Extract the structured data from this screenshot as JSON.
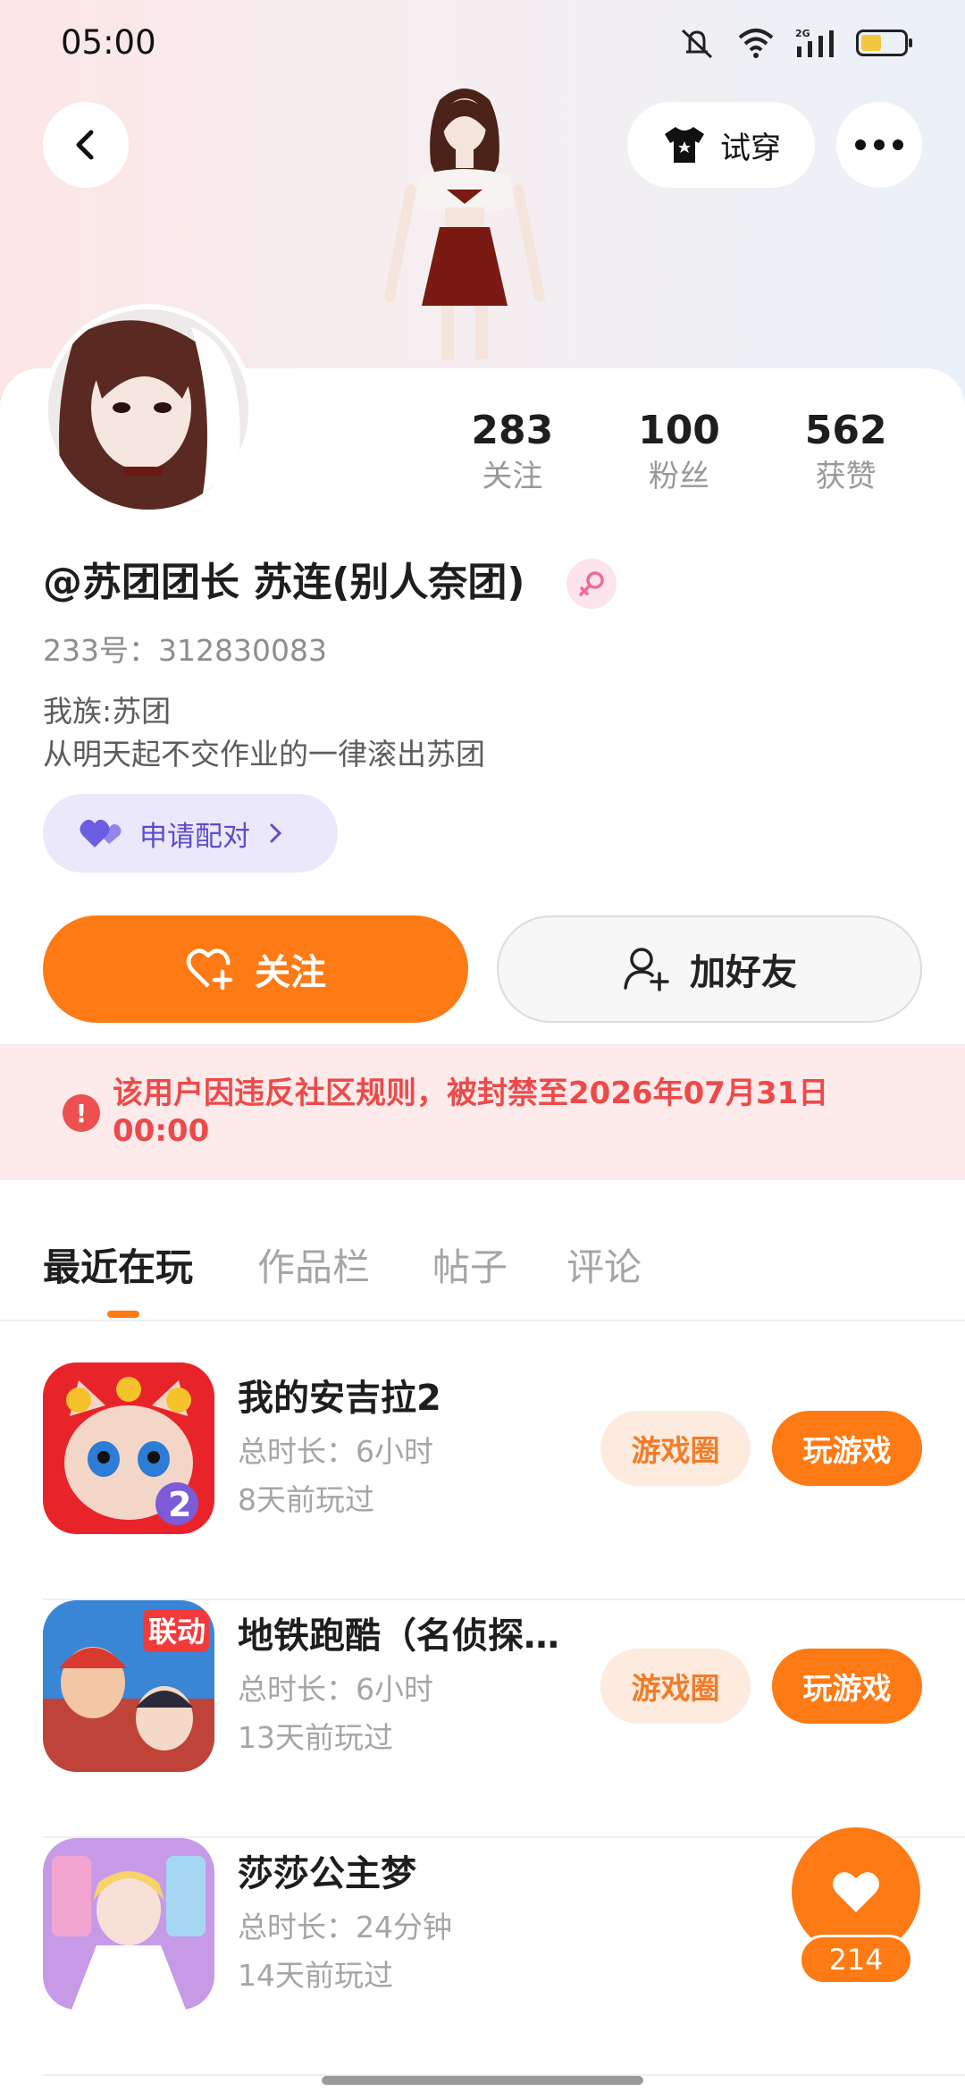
{
  "status_bar": {
    "time": "05:00"
  },
  "header": {
    "tryon_label": "试穿"
  },
  "profile": {
    "stats": [
      {
        "value": "283",
        "label": "关注"
      },
      {
        "value": "100",
        "label": "粉丝"
      },
      {
        "value": "562",
        "label": "获赞"
      }
    ],
    "nickname": "@苏团团长 苏连(别人奈团)",
    "uid": "233号：312830083",
    "bio_line1": "我族:苏团",
    "bio_line2": "从明天起不交作业的一律滚出苏团",
    "pair_label": "申请配对"
  },
  "actions": {
    "follow_label": "关注",
    "add_friend_label": "加好友"
  },
  "ban_notice": "该用户因违反社区规则，被封禁至2026年07月31日 00:00",
  "tabs": [
    {
      "label": "最近在玩",
      "active": true
    },
    {
      "label": "作品栏",
      "active": false
    },
    {
      "label": "帖子",
      "active": false
    },
    {
      "label": "评论",
      "active": false
    }
  ],
  "games": [
    {
      "name": "我的安吉拉2",
      "duration": "总时长：6小时",
      "last_played": "8天前玩过",
      "circle_label": "游戏圈",
      "play_label": "玩游戏"
    },
    {
      "name": "地铁跑酷（名侦探…",
      "duration": "总时长：6小时",
      "last_played": "13天前玩过",
      "circle_label": "游戏圈",
      "play_label": "玩游戏"
    },
    {
      "name": "莎莎公主梦",
      "duration": "总时长：24分钟",
      "last_played": "14天前玩过"
    }
  ],
  "like_count": "214",
  "colors": {
    "accent": "#fe7a14",
    "ban_text": "#ec4a4a",
    "pair_purple": "#5b4dc8"
  }
}
